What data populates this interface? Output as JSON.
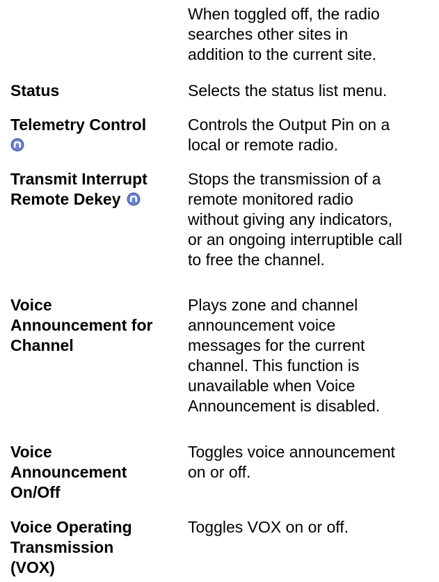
{
  "document": {
    "rows": [
      {
        "term_lines": [],
        "term_icon": "",
        "desc_lines": [
          "When toggled off, the radio",
          "searches other sites in",
          "addition to the current site."
        ]
      },
      {
        "term_lines": [
          "Status"
        ],
        "term_icon": "",
        "desc_lines": [
          "Selects the status list menu."
        ]
      },
      {
        "term_lines": [
          "Telemetry Control",
          ""
        ],
        "term_icon": "feature-icon",
        "desc_lines": [
          "Controls the Output Pin on a",
          "local or remote radio."
        ]
      },
      {
        "term_lines": [
          "Transmit Interrupt",
          "Remote Dekey"
        ],
        "term_icon": "feature-icon",
        "desc_lines": [
          "Stops the transmission of a",
          "remote monitored radio",
          "without giving any indicators,",
          "or an ongoing interruptible call",
          "to free the channel."
        ]
      },
      {
        "term_lines": [
          "Voice",
          "Announcement for",
          "Channel"
        ],
        "term_icon": "",
        "desc_lines": [
          "Plays zone and channel",
          "announcement voice",
          "messages for the current",
          "channel. This function is",
          "unavailable when Voice",
          "Announcement is disabled."
        ]
      },
      {
        "term_lines": [
          "Voice",
          "Announcement",
          "On/Off"
        ],
        "term_icon": "",
        "desc_lines": [
          "Toggles voice announcement",
          "on or off."
        ]
      },
      {
        "term_lines": [
          "Voice Operating",
          "Transmission",
          "(VOX)"
        ],
        "term_icon": "",
        "desc_lines": [
          "Toggles VOX on or off."
        ]
      }
    ],
    "icon_color": "#4a5fa8"
  }
}
